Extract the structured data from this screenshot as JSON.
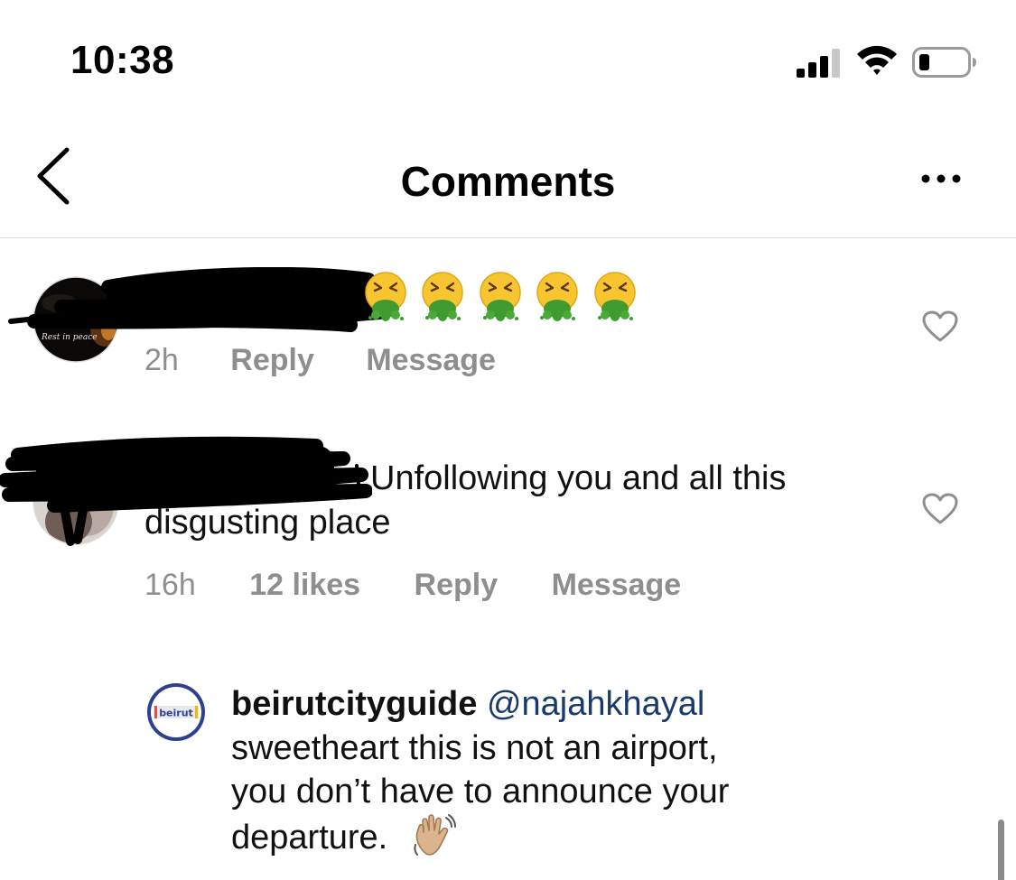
{
  "status_bar": {
    "time": "10:38"
  },
  "header": {
    "title": "Comments",
    "back_icon": "chevron-left-icon",
    "more_icon": "ellipsis-icon"
  },
  "comments": [
    {
      "text": "🤮🤮🤮🤮🤮",
      "avatar_text": "Rest in peace",
      "time": "2h",
      "reply_label": "Reply",
      "message_label": "Message"
    },
    {
      "text_line1": "Unfollowing you and all this",
      "text_line2": "disgusting place",
      "time": "16h",
      "likes": "12 likes",
      "reply_label": "Reply",
      "message_label": "Message"
    }
  ],
  "reply": {
    "username": "beirutcityguide",
    "mention": "@najahkhayal",
    "line1": "sweetheart this is not an airport,",
    "line2": "you don’t have to announce your",
    "line3": "departure.",
    "avatar_text": "beirut",
    "emoji": "👋🏼"
  },
  "colors": {
    "meta_gray": "#8e8e8e",
    "mention_blue": "#1a3a6e",
    "divider": "#dbdbdb",
    "avatar_ring": "#2d3f8f"
  }
}
